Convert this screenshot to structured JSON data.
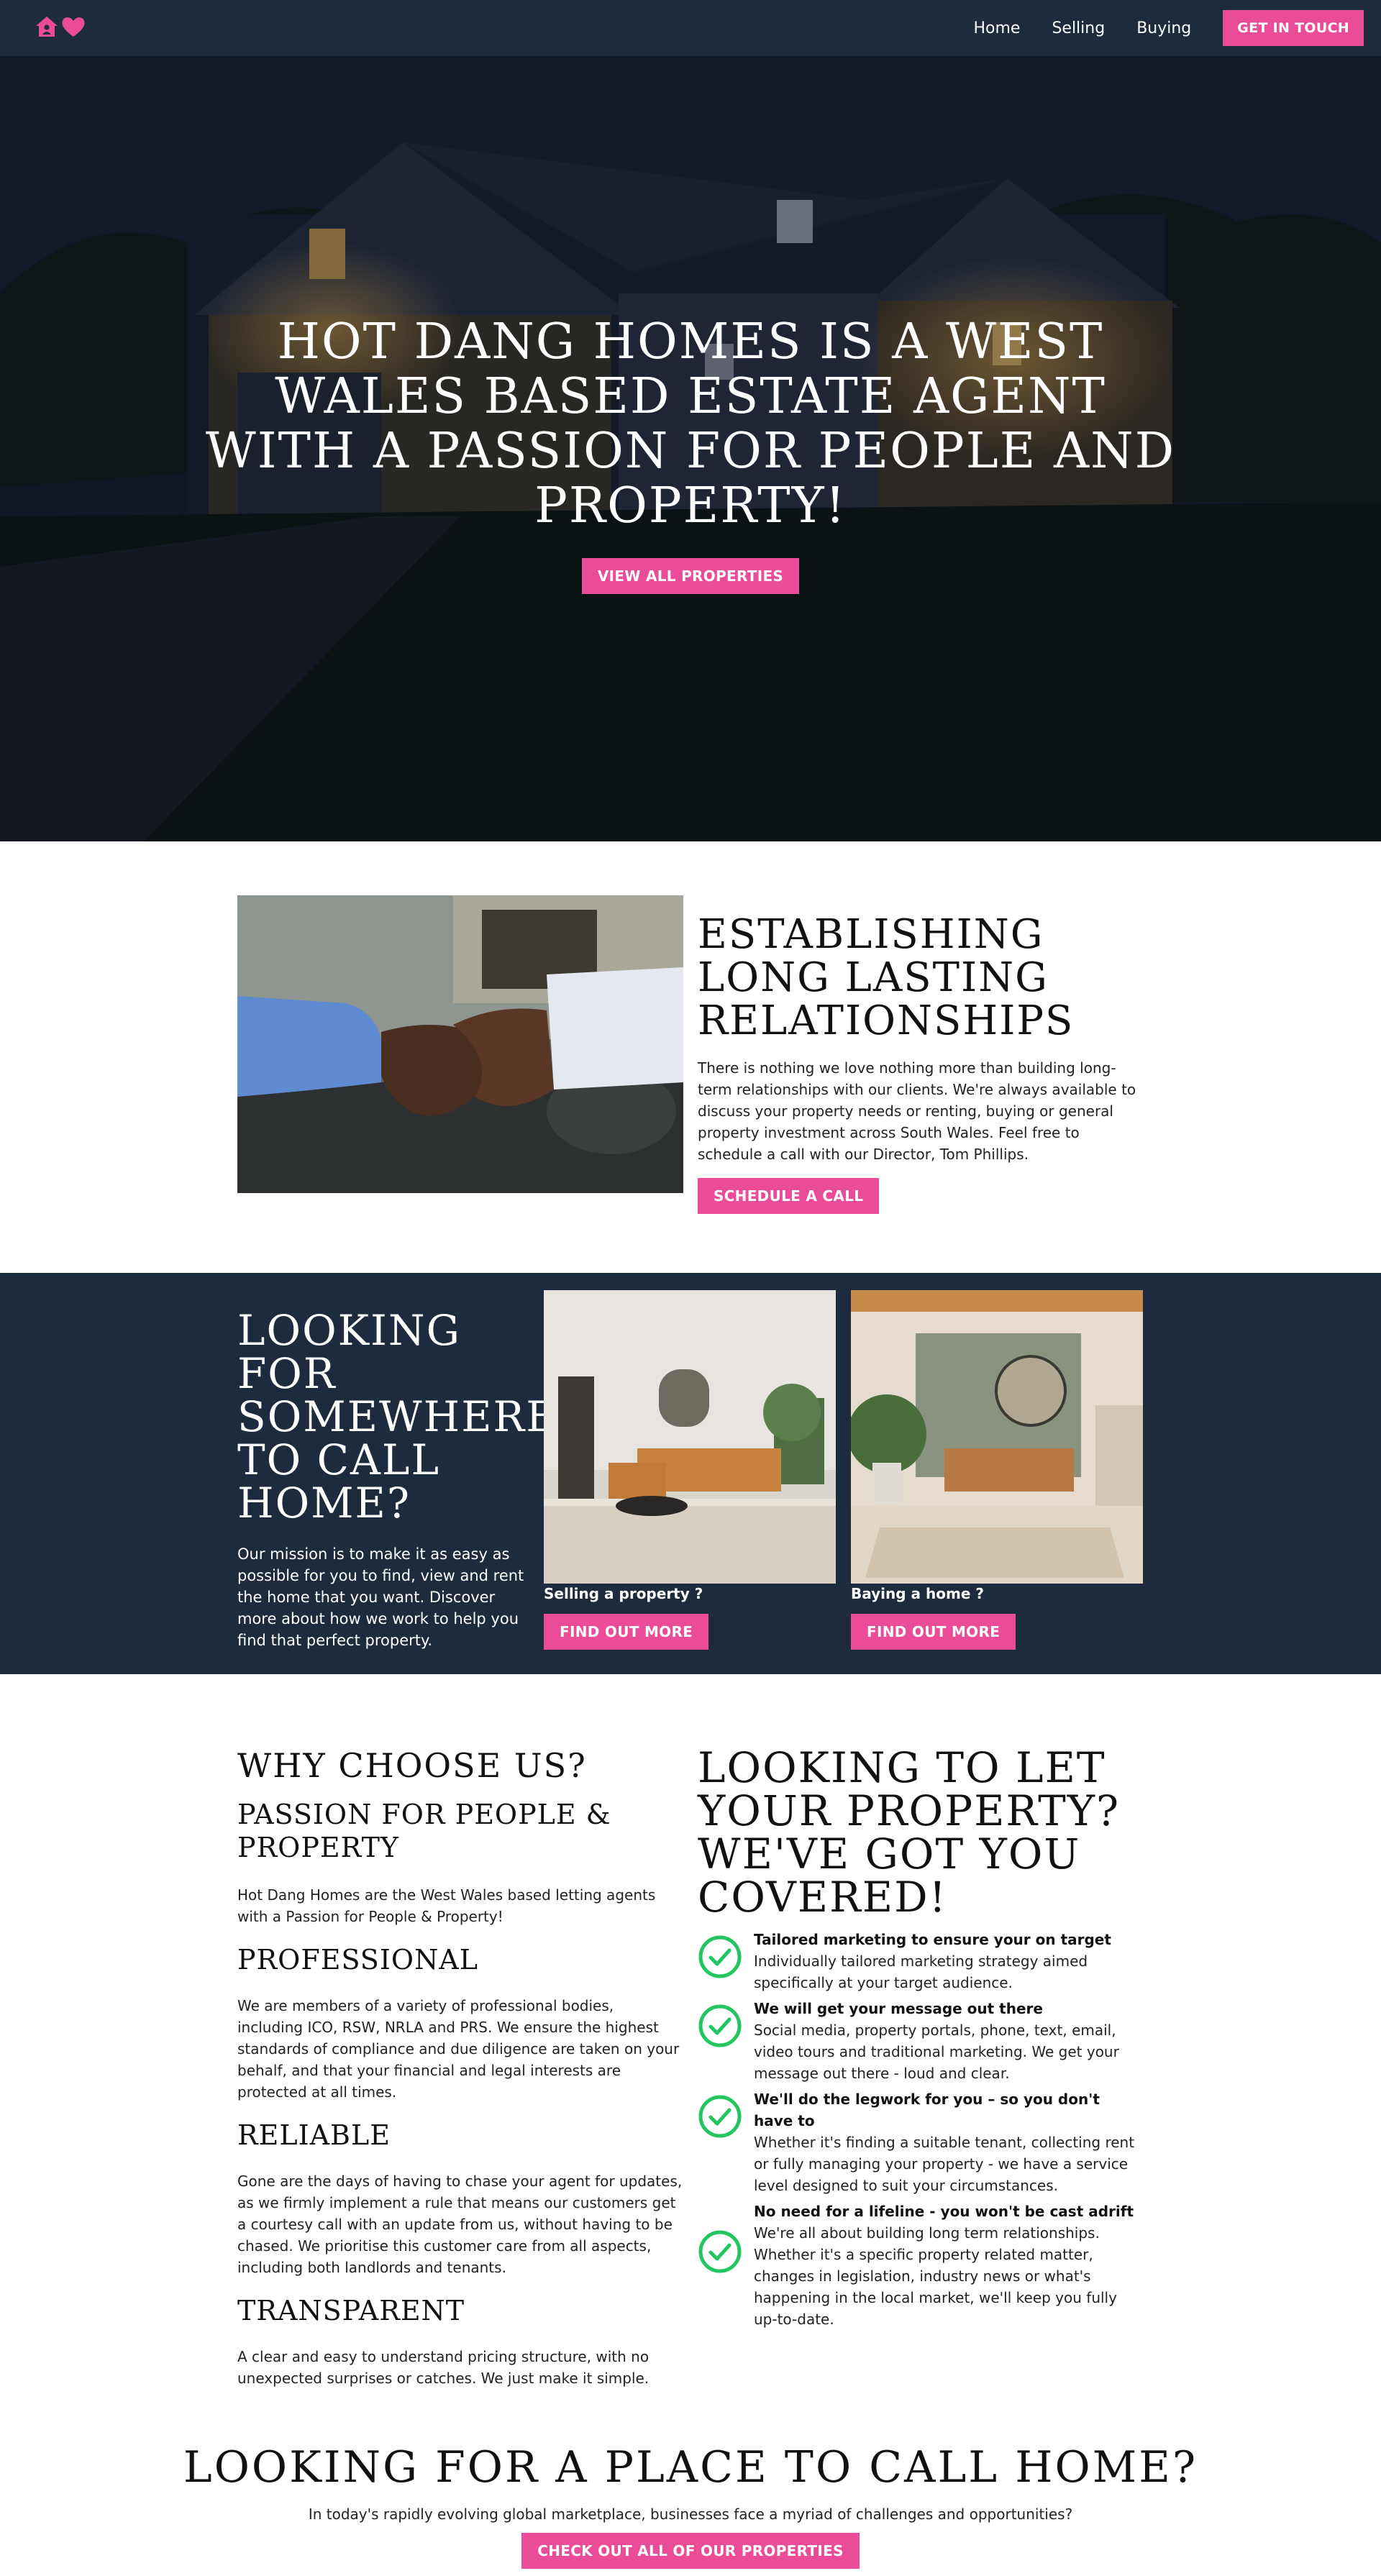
{
  "nav": {
    "links": [
      "Home",
      "Selling",
      "Buying"
    ],
    "cta": "GET IN TOUCH",
    "logo_icons": [
      "home-icon",
      "heart-icon"
    ]
  },
  "hero": {
    "title": "HOT DANG HOMES IS A WEST WALES BASED ESTATE AGENT WITH A PASSION FOR PEOPLE AND PROPERTY!",
    "button": "VIEW ALL PROPERTIES"
  },
  "about": {
    "heading": "ESTABLISHING LONG LASTING RELATIONSHIPS",
    "body": "There is nothing we love nothing more than building long-term relationships with our clients. We're always available to discuss your property needs or renting, buying or general property investment across South Wales. Feel free to schedule a call with our Director, Tom Phillips.",
    "button": "SCHEDULE A CALL"
  },
  "looking": {
    "heading": "LOOKING FOR SOMEWHERE TO CALL HOME?",
    "body": "Our mission is to make it as easy as possible for you to find, view and rent the home that you want. Discover more about how we work to help you find that perfect property.",
    "cards": [
      {
        "caption": "Selling a property ?",
        "button": "FIND OUT MORE"
      },
      {
        "caption": "Baying a home ?",
        "button": "FIND OUT MORE"
      }
    ]
  },
  "why": {
    "heading": "WHY CHOOSE US?",
    "sections": [
      {
        "title": "PASSION FOR PEOPLE & PROPERTY",
        "body": "Hot Dang Homes are the West Wales based letting agents with a Passion for People & Property!"
      },
      {
        "title": "PROFESSIONAL",
        "body": "We are members of a variety of professional bodies, including ICO, RSW, NRLA and PRS. We ensure the highest standards of compliance and due diligence are taken on your behalf, and that your financial and legal interests are protected at all times."
      },
      {
        "title": "RELIABLE",
        "body": "Gone are the days of having to chase your agent for updates, as we firmly implement a rule that means our customers get a courtesy call with an update from us, without having to be chased. We prioritise this customer care from all aspects, including both landlords and tenants."
      },
      {
        "title": "TRANSPARENT",
        "body": "A clear and easy to understand pricing structure, with no unexpected surprises or catches. We just make it simple."
      }
    ]
  },
  "letting": {
    "heading": "LOOKING TO LET YOUR PROPERTY? WE'VE GOT YOU COVERED!",
    "features": [
      {
        "title": "Tailored marketing to ensure your on target",
        "body": "Individually tailored marketing strategy aimed specifically at your target audience."
      },
      {
        "title": "We will get your message out there",
        "body": "Social media, property portals, phone, text, email, video tours and traditional marketing. We get your message out there - loud and clear."
      },
      {
        "title": "We'll do the legwork for you – so you don't have to",
        "body": "Whether it's finding a suitable tenant, collecting rent or fully managing your property - we have a service level designed to suit your circumstances."
      },
      {
        "title": "No need for a lifeline - you won't be cast adrift",
        "body": "We're all about building long term relationships. Whether it's a specific property related matter, changes in legislation, industry news or what's happening in the local market, we'll keep you fully up-to-date."
      }
    ]
  },
  "bottom": {
    "heading": "LOOKING FOR A PLACE TO CALL HOME?",
    "body": "In today's rapidly evolving global marketplace, businesses face a myriad of challenges and opportunities?",
    "button": "CHECK OUT ALL OF OUR PROPERTIES"
  },
  "colors": {
    "accent": "#ea4c97",
    "navy": "#1e2a3d",
    "check": "#22c55e"
  }
}
